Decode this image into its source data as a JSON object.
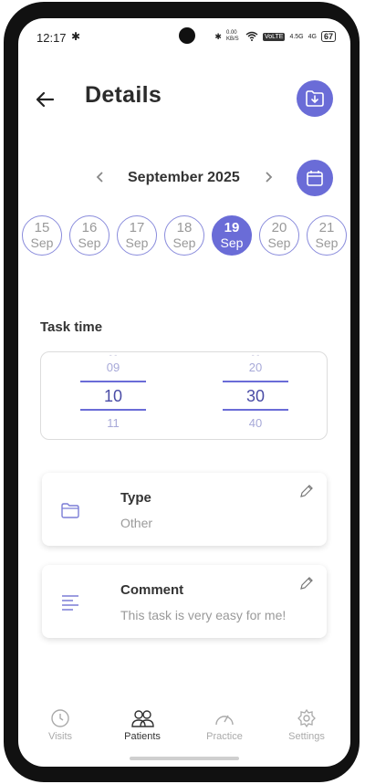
{
  "status": {
    "time": "12:17",
    "data_speed": "0.00 KB/S",
    "volte": "VoLTE",
    "net1": "4.5G",
    "net2": "4G",
    "battery": "67"
  },
  "header": {
    "title": "Details"
  },
  "calendar": {
    "month_label": "September 2025",
    "days": [
      {
        "num": "15",
        "mon": "Sep",
        "selected": false
      },
      {
        "num": "16",
        "mon": "Sep",
        "selected": false
      },
      {
        "num": "17",
        "mon": "Sep",
        "selected": false
      },
      {
        "num": "18",
        "mon": "Sep",
        "selected": false
      },
      {
        "num": "19",
        "mon": "Sep",
        "selected": true
      },
      {
        "num": "20",
        "mon": "Sep",
        "selected": false
      },
      {
        "num": "21",
        "mon": "Sep",
        "selected": false
      }
    ]
  },
  "task_time": {
    "label": "Task time",
    "hours": {
      "above": "09",
      "current": "10",
      "below": "11"
    },
    "minutes": {
      "above": "20",
      "current": "30",
      "below": "40"
    }
  },
  "cards": {
    "type": {
      "title": "Type",
      "value": "Other"
    },
    "comment": {
      "title": "Comment",
      "value": "This task is very easy for me!"
    }
  },
  "nav": {
    "items": [
      {
        "label": "Visits",
        "icon": "clock-icon",
        "active": false
      },
      {
        "label": "Patients",
        "icon": "people-icon",
        "active": true
      },
      {
        "label": "Practice",
        "icon": "gauge-icon",
        "active": false
      },
      {
        "label": "Settings",
        "icon": "gear-icon",
        "active": false
      }
    ]
  },
  "colors": {
    "accent": "#6a6cd7",
    "day_border": "#8a8cdc",
    "picker_line": "#6a6cd7"
  }
}
